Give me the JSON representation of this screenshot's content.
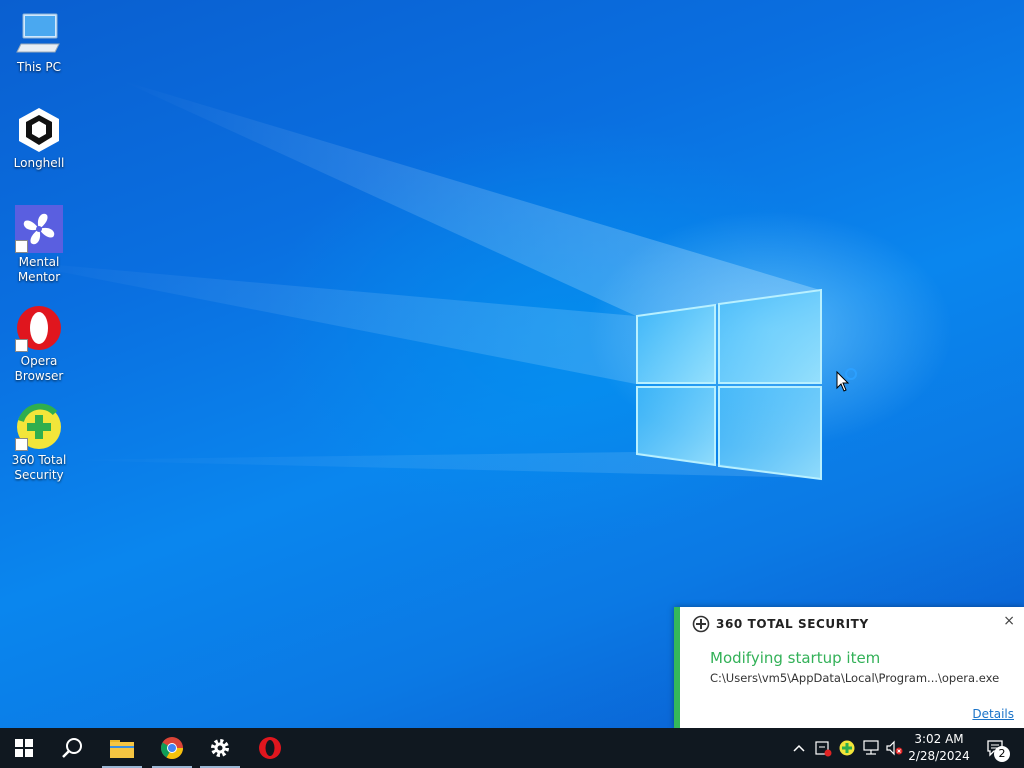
{
  "desktop": {
    "icons": [
      {
        "label": "This PC",
        "icon": "computer-icon"
      },
      {
        "label": "Longhell",
        "icon": "unity-icon"
      },
      {
        "label": "Mental\nMentor",
        "icon": "pinwheel-icon"
      },
      {
        "label": "Opera\nBrowser",
        "icon": "opera-icon"
      },
      {
        "label": "360 Total\nSecurity",
        "icon": "360-security-icon"
      }
    ]
  },
  "taskbar": {
    "pinned": [
      "start-icon",
      "search-icon",
      "file-explorer-icon",
      "chrome-icon",
      "settings-icon",
      "opera-icon"
    ],
    "tray": [
      "chevron-up-icon",
      "security-alert-icon",
      "360-tray-icon",
      "network-icon",
      "volume-muted-icon"
    ],
    "clock": {
      "time": "3:02 AM",
      "date": "2/28/2024"
    },
    "notifications": {
      "count": "2",
      "icon": "action-center-icon"
    }
  },
  "toast": {
    "brand": "360 TOTAL SECURITY",
    "close": "×",
    "title": "Modifying startup item",
    "path": "C:\\Users\\vm5\\AppData\\Local\\Program...\\opera.exe",
    "details_label": "Details"
  },
  "colors": {
    "accent_green": "#33b158",
    "link_blue": "#1a73c8",
    "taskbar_bg": "#101820"
  }
}
